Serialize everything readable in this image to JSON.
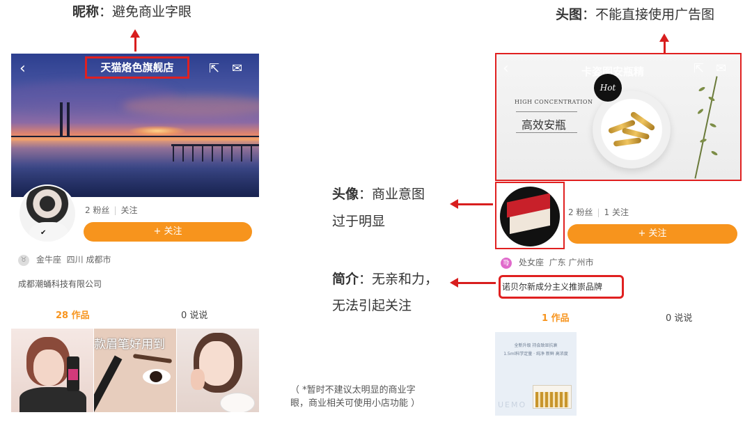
{
  "annotations": {
    "nickname": {
      "label": "昵称",
      "text": "：避免商业字眼"
    },
    "cover": {
      "label": "头图",
      "text": "：不能直接使用广告图"
    },
    "avatar": {
      "label": "头像",
      "text": "：商业意图",
      "line2": "过于明显"
    },
    "bio": {
      "label": "简介",
      "text": "：无亲和力，",
      "line2": "无法引起关注"
    },
    "footnote": {
      "line1": "（ *暂时不建议太明显的商业字",
      "line2": "眼，商业相关可使用小店功能 ）"
    }
  },
  "left_profile": {
    "title": "天猫烙色旗舰店",
    "fans": "2 粉丝",
    "following": "关注",
    "follow_button": "+ 关注",
    "zodiac": "金牛座",
    "location": "四川 成都市",
    "bio": "成都潮蛹科技有限公司",
    "tab_works": "28 作品",
    "tab_posts": "0 说说",
    "thumb_caption": "款眉笔好用到"
  },
  "right_profile": {
    "cover_title": "卡姿图安瓶精",
    "cover_hot": "Hot",
    "cover_hc": "HIGH CONCENTRATION",
    "cover_product": "高效安瓶",
    "fans": "2 粉丝",
    "following": "1 关注",
    "follow_button": "+ 关注",
    "zodiac": "处女座",
    "location": "广东 广州市",
    "bio": "诺贝尔新成分主义推崇品牌",
    "tab_works": "1 作品",
    "tab_posts": "0 说说",
    "thumb_line1": "全新升级 持会致显抗衰",
    "thumb_line2": "1.5ml科学定量 · 纯净 新鲜 高浓度",
    "thumb_brand": "UEMO"
  },
  "colors": {
    "accent": "#f7941d",
    "highlight": "#e02020",
    "arrow": "#d81e1e"
  }
}
